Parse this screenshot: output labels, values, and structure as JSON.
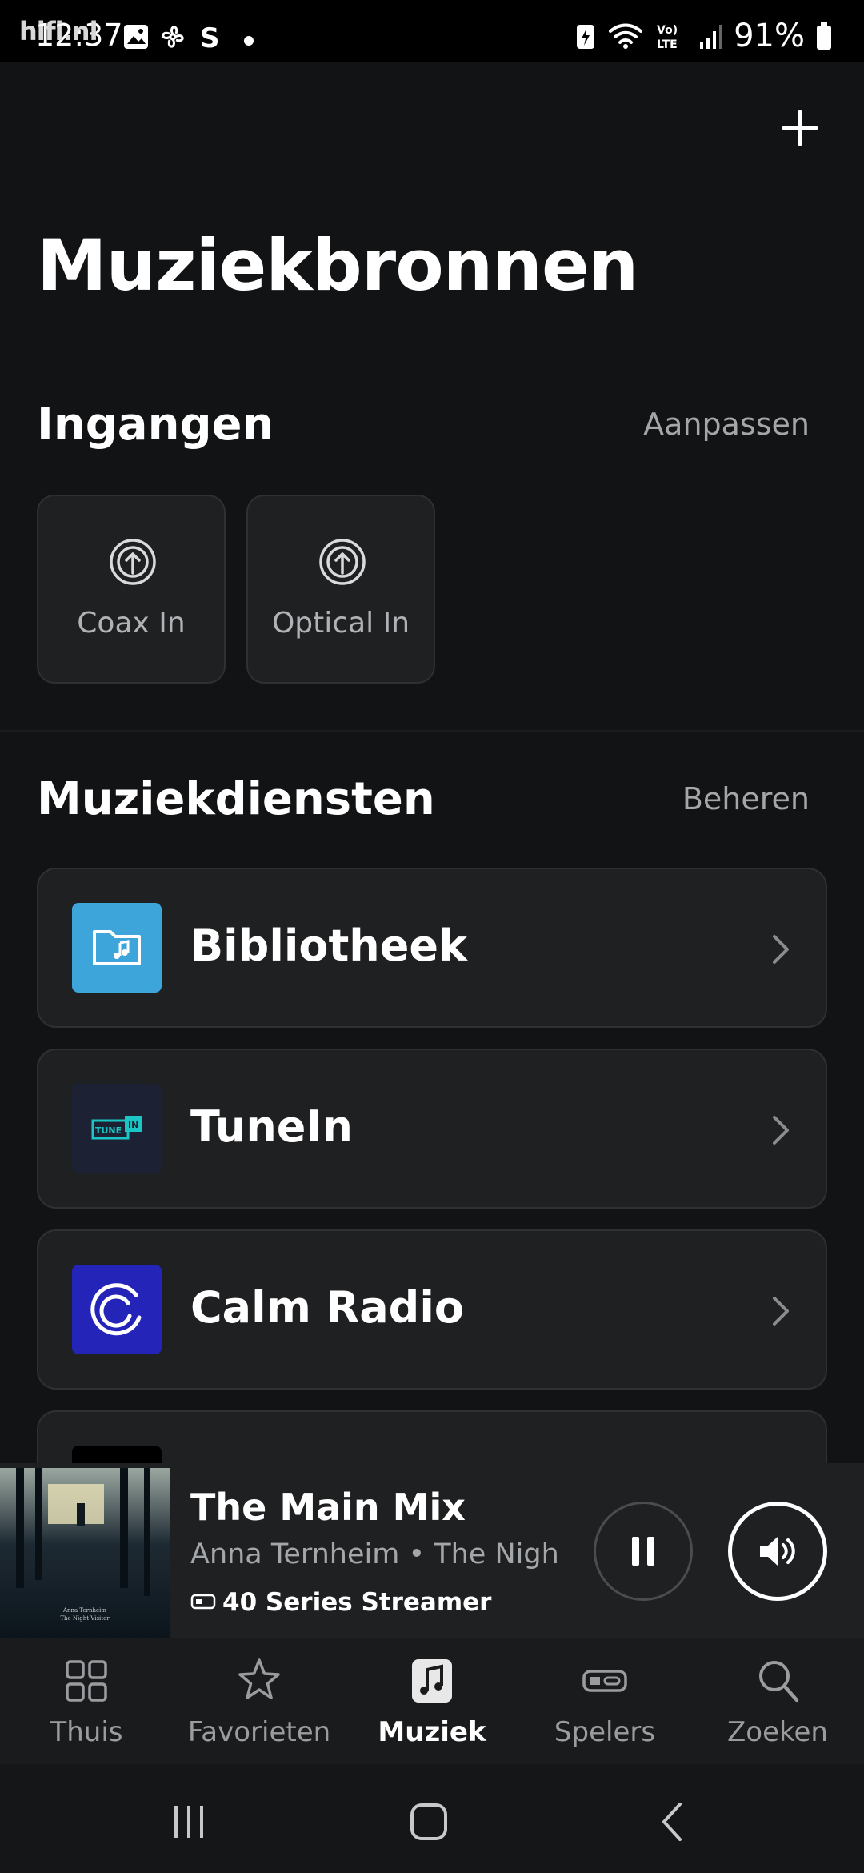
{
  "status_bar": {
    "time": "12:37",
    "watermark": "hifi.nl",
    "battery": "91%",
    "icons": [
      "gallery-icon",
      "fan-icon",
      "s-icon",
      "dot-icon",
      "battery-saver-icon",
      "wifi-icon",
      "volte-icon",
      "signal-icon",
      "battery-icon"
    ]
  },
  "header": {
    "title": "Muziekbronnen",
    "add_icon": "plus-icon"
  },
  "inputs": {
    "title": "Ingangen",
    "action": "Aanpassen",
    "items": [
      {
        "label": "Coax In",
        "icon": "input-icon"
      },
      {
        "label": "Optical In",
        "icon": "input-icon"
      }
    ]
  },
  "services": {
    "title": "Muziekdiensten",
    "action": "Beheren",
    "items": [
      {
        "name": "Bibliotheek",
        "icon": "library-folder-icon",
        "color": "#3ea5da"
      },
      {
        "name": "TuneIn",
        "icon": "tunein-logo",
        "color": "#1c2233"
      },
      {
        "name": "Calm Radio",
        "icon": "calm-radio-logo",
        "color": "#2424b8"
      },
      {
        "name": "",
        "icon": "service-logo",
        "color": "#000000"
      }
    ]
  },
  "now_playing": {
    "title": "The Main Mix",
    "subtitle": "Anna Ternheim • The Night V",
    "player": "40 Series Streamer",
    "album_art_text": [
      "Anna Ternheim",
      "The Night Visitor"
    ]
  },
  "tabs": [
    {
      "label": "Thuis",
      "icon": "home-grid-icon",
      "active": false
    },
    {
      "label": "Favorieten",
      "icon": "star-icon",
      "active": false
    },
    {
      "label": "Muziek",
      "icon": "music-note-icon",
      "active": true
    },
    {
      "label": "Spelers",
      "icon": "speaker-device-icon",
      "active": false
    },
    {
      "label": "Zoeken",
      "icon": "search-icon",
      "active": false
    }
  ],
  "nav": [
    "recents-icon",
    "home-icon",
    "back-icon"
  ],
  "colors": {
    "background": "#121314",
    "card": "#1e2022",
    "accent_text": "#ffffff",
    "muted_text": "#a4a7aa"
  }
}
